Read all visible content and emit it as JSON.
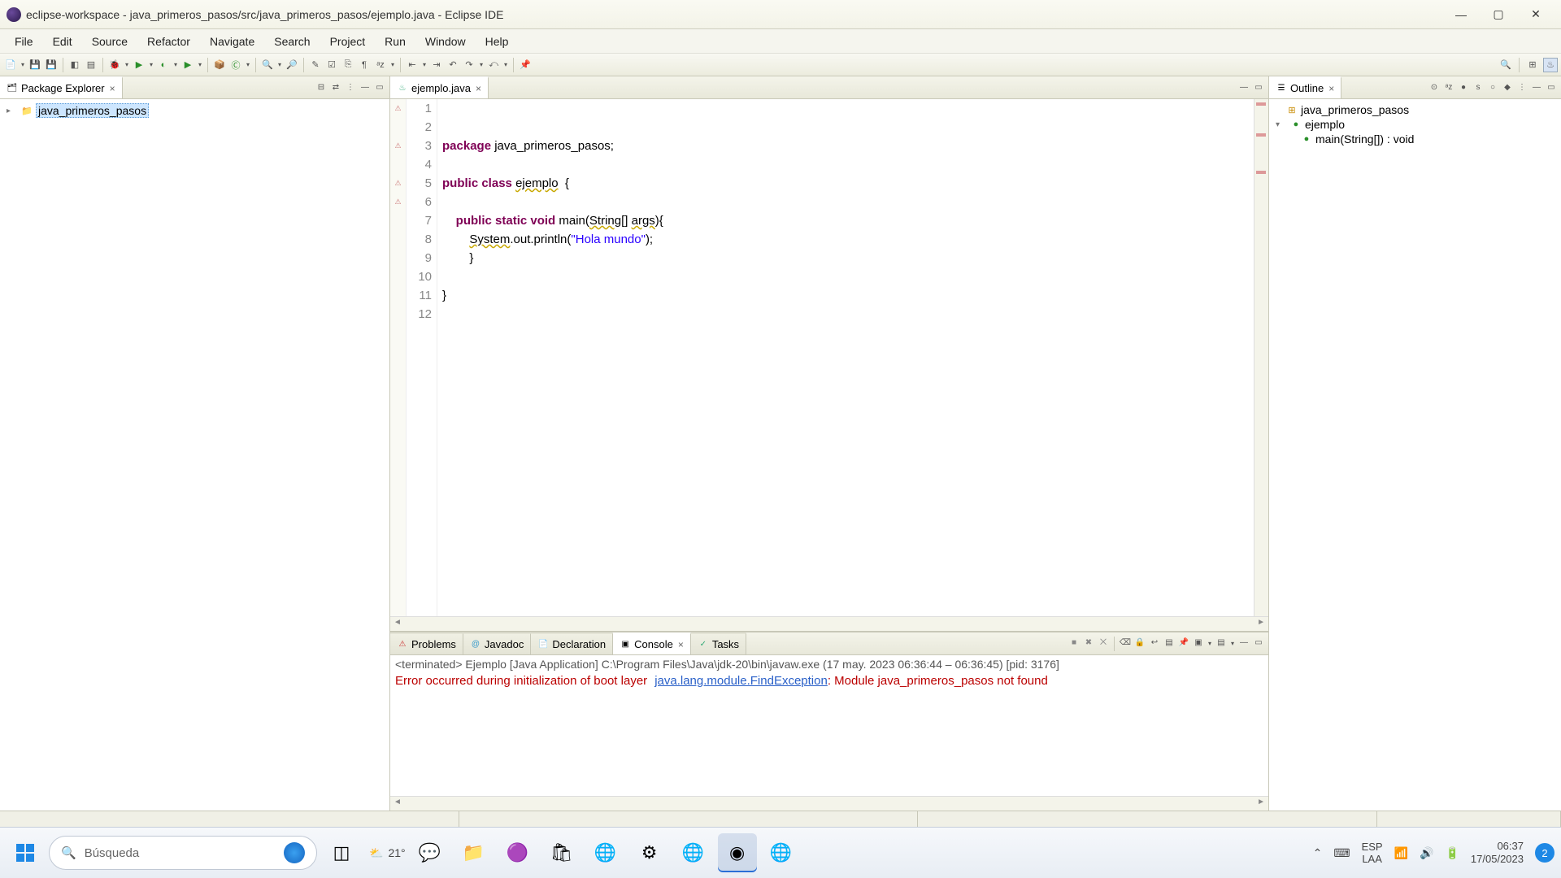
{
  "window": {
    "title": "eclipse-workspace - java_primeros_pasos/src/java_primeros_pasos/ejemplo.java - Eclipse IDE"
  },
  "menu": [
    "File",
    "Edit",
    "Source",
    "Refactor",
    "Navigate",
    "Search",
    "Project",
    "Run",
    "Window",
    "Help"
  ],
  "panels": {
    "packageExplorer": {
      "title": "Package Explorer",
      "items": [
        "java_primeros_pasos"
      ]
    },
    "editor": {
      "tab": "ejemplo.java",
      "lines": {
        "n1": "1",
        "n2": "2",
        "n3": "3",
        "n4": "4",
        "n5": "5",
        "n6": "6",
        "n7": "7",
        "n8": "8",
        "n9": "9",
        "n10": "10",
        "n11": "11",
        "n12": "12"
      },
      "code": {
        "l1a": "package",
        "l1b": " java_primeros_pasos;",
        "l3a": "public",
        "l3b": " ",
        "l3c": "class",
        "l3d": " ",
        "l3e": "ejemplo",
        "l3f": "  {",
        "l5a": "    ",
        "l5b": "public",
        "l5c": " ",
        "l5d": "static",
        "l5e": " ",
        "l5f": "void",
        "l5g": " main(",
        "l5h": "String",
        "l5i": "[] ",
        "l5j": "args",
        "l5k": "){",
        "l6a": "        ",
        "l6b": "System",
        "l6c": ".out.println(",
        "l6d": "\"Hola mundo\"",
        "l6e": ");",
        "l7": "        }",
        "l9": "}"
      }
    },
    "outline": {
      "title": "Outline",
      "items": {
        "pkg": "java_primeros_pasos",
        "cls": "ejemplo",
        "mth": "main(String[]) : void"
      }
    },
    "bottomTabs": {
      "problems": "Problems",
      "javadoc": "Javadoc",
      "declaration": "Declaration",
      "console": "Console",
      "tasks": "Tasks"
    },
    "console": {
      "header": "<terminated> Ejemplo [Java Application] C:\\Program Files\\Java\\jdk-20\\bin\\javaw.exe  (17 may. 2023 06:36:44 – 06:36:45) [pid: 3176]",
      "line1": "Error occurred during initialization of boot layer",
      "line2a": "java.lang.module.FindException",
      "line2b": ": Module java_primeros_pasos not found"
    }
  },
  "taskbar": {
    "searchPlaceholder": "Búsqueda",
    "weather": "21°",
    "lang1": "ESP",
    "lang2": "LAA",
    "time": "06:37",
    "date": "17/05/2023",
    "notif": "2"
  }
}
